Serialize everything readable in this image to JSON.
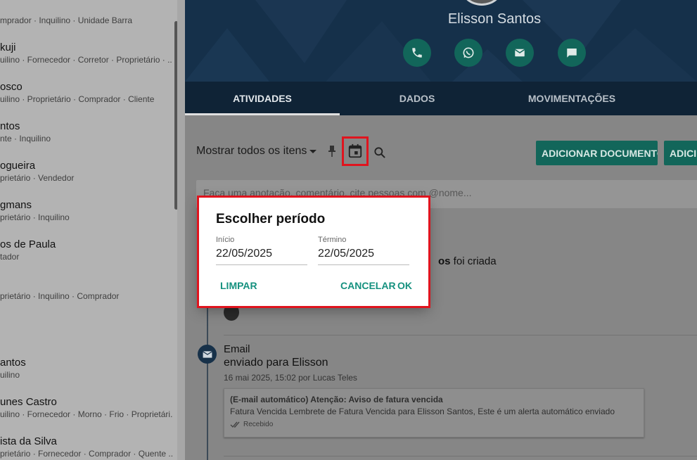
{
  "contacts": [
    {
      "name": "",
      "tags": "mprador · Inquilino · Unidade Barra"
    },
    {
      "name": "kuji",
      "tags": "uilino · Fornecedor · Corretor · Proprietário · ..."
    },
    {
      "name": "osco",
      "tags": "uilino · Proprietário · Comprador · Cliente"
    },
    {
      "name": "ntos",
      "tags": "nte · Inquilino"
    },
    {
      "name": "ogueira",
      "tags": "prietário · Vendedor"
    },
    {
      "name": "gmans",
      "tags": "prietário · Inquilino"
    },
    {
      "name": "os de Paula",
      "tags": "tador"
    },
    {
      "name": "",
      "tags": "prietário · Inquilino · Comprador"
    },
    {
      "name": "antos",
      "tags": "uilino"
    },
    {
      "name": "unes Castro",
      "tags": "uilino · Fornecedor · Morno · Frio · Proprietári..."
    },
    {
      "name": "ista da Silva",
      "tags": "prietário · Fornecedor · Comprador · Quente ..."
    }
  ],
  "profile": {
    "name": "Elisson Santos",
    "actions": [
      "phone-icon",
      "whatsapp-icon",
      "mail-icon",
      "message-icon"
    ]
  },
  "tabs": [
    "ATIVIDADES",
    "DADOS",
    "MOVIMENTAÇÕES"
  ],
  "toolbar": {
    "filter_label": "Mostrar todos os itens",
    "add_document": "ADICIONAR DOCUMENTO",
    "add_more": "ADICI"
  },
  "note_placeholder": "Faça uma anotação, comentário, cite pessoas com @nome...",
  "timeline": {
    "created_bold": "os",
    "created_text": " foi criada",
    "email_title": "Email",
    "email_subtitle": "enviado para Elisson",
    "email_meta": "16 mai 2025, 15:02 por Lucas Teles",
    "card_title": "(E-mail automático) Atenção: Aviso de fatura vencida",
    "card_body": "Fatura Vencida Lembrete de Fatura Vencida para Elisson Santos, Este é um alerta automático enviado",
    "card_status": "Recebido"
  },
  "dialog": {
    "title": "Escolher período",
    "start_label": "Início",
    "start_value": "22/05/2025",
    "end_label": "Término",
    "end_value": "22/05/2025",
    "clear": "LIMPAR",
    "cancel": "CANCELAR",
    "ok": "OK"
  },
  "colors": {
    "accent": "#12665a",
    "header": "#15304a",
    "highlight": "#e0141e"
  }
}
